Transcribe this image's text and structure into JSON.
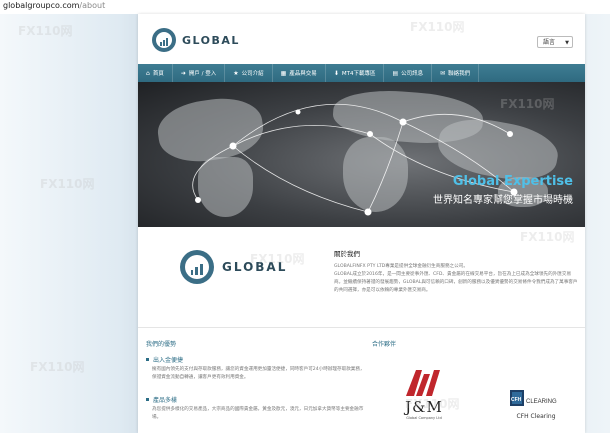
{
  "browser": {
    "url_domain": "globalgroupco.com",
    "url_path": "/about"
  },
  "header": {
    "logo_text": "GLOBAL",
    "language_select": "語言"
  },
  "nav": {
    "items": [
      {
        "icon": "home-icon",
        "glyph": "⌂",
        "label": "首頁"
      },
      {
        "icon": "login-icon",
        "glyph": "➜",
        "label": "開戶 / 登入"
      },
      {
        "icon": "star-icon",
        "glyph": "★",
        "label": "公司介紹"
      },
      {
        "icon": "chart-icon",
        "glyph": "▦",
        "label": "產品與交易"
      },
      {
        "icon": "download-icon",
        "glyph": "⬇",
        "label": "MT4下載專區"
      },
      {
        "icon": "news-icon",
        "glyph": "▤",
        "label": "公司訊息"
      },
      {
        "icon": "contact-icon",
        "glyph": "✉",
        "label": "聯絡我們"
      }
    ]
  },
  "hero": {
    "title": "Global Expertise",
    "subtitle": "世界知名專家幫您掌握市場時機"
  },
  "about": {
    "logo_text": "GLOBAL",
    "title": "關於我們",
    "paragraphs": [
      "GLOBALFINFX PTY LTD專業是提供全球金融衍生商服務之公司。",
      "GLOBAL成立於2016年，是一間主要從事外匯、CFD、貴金屬的在線交易平台，旨在為上已成為全球領先的外匯交易商。並繼續保持著證的發展趨勢，GLOBAL與可信賴的口碑，創新的服務以及優異優勢的交易條件令我們成為了萬事客戶的共同選擇，亦是可以依賴的專業外匯交易商。"
    ]
  },
  "advantages": {
    "title": "我們的優勢",
    "items": [
      {
        "heading": "出入金便捷",
        "text": "擁有國內領先的支付與存取款服務，讓您的資金運用更加靈活便捷，同時客戶可24小時辦理存取款業務，保證資金流動自轉通，讓客戶更有效利用資金。"
      },
      {
        "heading": "產品多樣",
        "text": "為您提供多樣化的交易產品，大宗商品的國際貴金屬，黃金及歐元，澳元，日元加拿大貨幣等主要金融市場。"
      }
    ]
  },
  "partners": {
    "title": "合作夥伴",
    "jm": {
      "name": "J&M",
      "tagline": "Global Company Ltd"
    },
    "cfh": {
      "logo_text": "CFH",
      "logo_sub": "CLEARING",
      "name": "CFH Clearing"
    }
  },
  "watermark": "FX110网",
  "colors": {
    "nav": "#2f6a80",
    "accent": "#4fc0e8",
    "brand": "#2c6d86",
    "jm_red": "#c0262c"
  }
}
